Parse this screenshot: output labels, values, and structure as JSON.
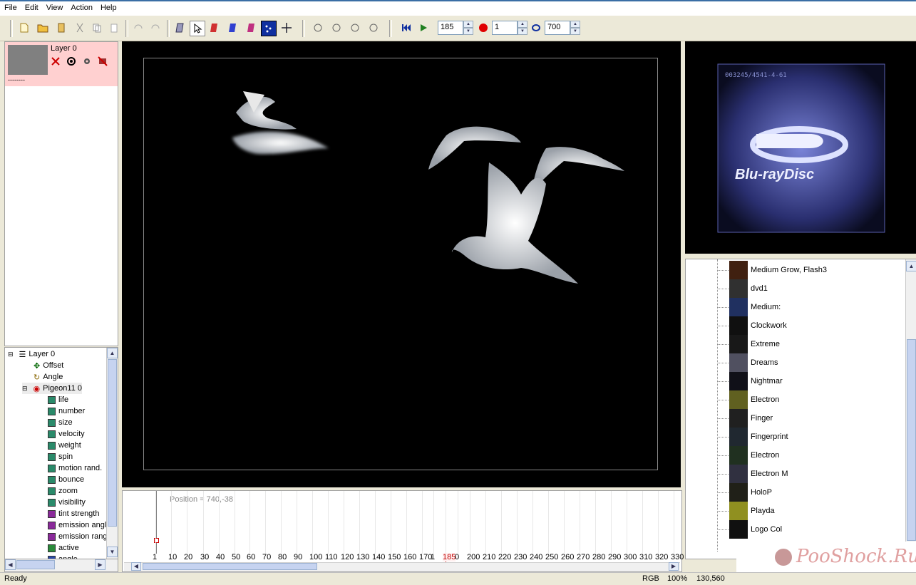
{
  "menu": [
    "File",
    "Edit",
    "View",
    "Action",
    "Help"
  ],
  "toolbar": {
    "frame_value": "185",
    "step_value": "1",
    "end_value": "700"
  },
  "layer_panel": {
    "layer_name": "Layer 0",
    "layer_dashes": "--------"
  },
  "tree": {
    "root": "Layer 0",
    "offset": "Offset",
    "angle": "Angle",
    "emitter": "Pigeon11 0",
    "params": [
      "life",
      "number",
      "size",
      "velocity",
      "weight",
      "spin",
      "motion rand.",
      "bounce",
      "zoom",
      "visibility",
      "tint strength",
      "emission angl",
      "emission rang",
      "active",
      "angle"
    ]
  },
  "timeline": {
    "position_text": "Position = 740,-38",
    "ticks": [
      "1",
      "10",
      "20",
      "30",
      "40",
      "50",
      "60",
      "70",
      "80",
      "90",
      "100",
      "110",
      "120",
      "130",
      "140",
      "150",
      "160",
      "170",
      "1",
      "185",
      "0",
      "200",
      "210",
      "220",
      "230",
      "240",
      "250",
      "260",
      "270",
      "280",
      "290",
      "300",
      "310",
      "320",
      "330"
    ],
    "current_frame": "185"
  },
  "preview": {
    "serial_text": "003245/4541-4-61",
    "logo_text": "Blu-rayDisc"
  },
  "list": {
    "items": [
      "Medium Grow, Flash3",
      "dvd1",
      "Medium:",
      "Clockwork",
      "Extreme",
      "Dreams",
      "Nightmar",
      "Electron",
      "Finger",
      "Fingerprint",
      "Electron",
      "Electron M",
      "HoloP",
      "Playda",
      "Logo Col"
    ]
  },
  "status": {
    "left": "Ready",
    "mode": "RGB",
    "zoom": "100%",
    "coords": "130,560"
  },
  "watermark": "PooShock.Ru",
  "colors": {
    "selected_layer_bg": "#ffd0d0",
    "playhead": "#c00000",
    "title_blue": "#3a6ea5"
  }
}
